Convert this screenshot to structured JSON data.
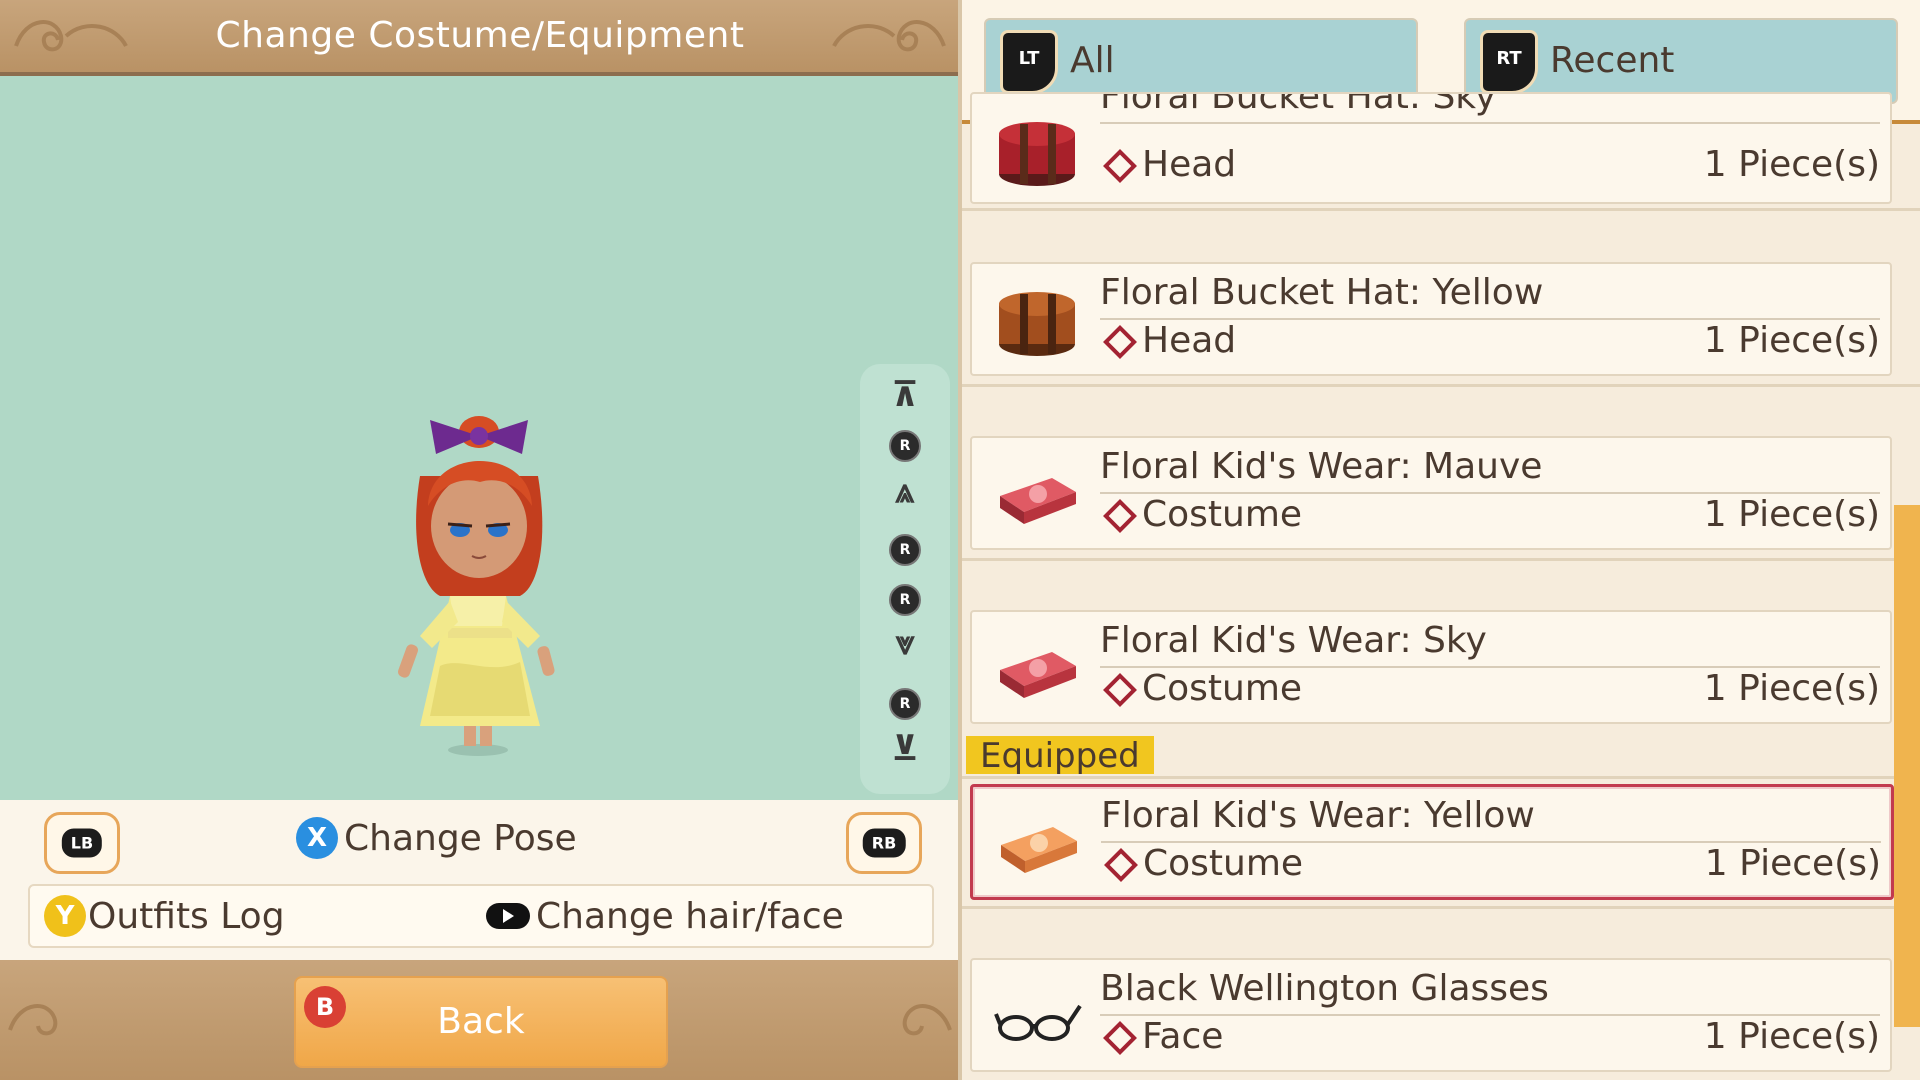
{
  "left": {
    "title": "Change Costume/Equipment",
    "camera_controls": [
      "top",
      "rotate-up",
      "zoom-in",
      "rotate-left",
      "rotate-right",
      "zoom-out",
      "rotate-down",
      "bottom"
    ],
    "camera_button_letter": "R",
    "lb_label": "LB",
    "rb_label": "RB",
    "change_pose": {
      "button": "X",
      "label": "Change Pose"
    },
    "outfits_log": {
      "button": "Y",
      "label": "Outfits Log"
    },
    "change_hair": {
      "label": "Change hair/face"
    },
    "back": {
      "button": "B",
      "label": "Back"
    }
  },
  "right": {
    "tabs": [
      {
        "badge": "LT",
        "label": "All"
      },
      {
        "badge": "RT",
        "label": "Recent"
      }
    ],
    "equipped_label": "Equipped",
    "items": [
      {
        "name": "Floral Bucket Hat: Sky",
        "slot": "Head",
        "qty": "1 Piece(s)",
        "icon": "red-hatbox-icon"
      },
      {
        "name": "Floral Bucket Hat: Yellow",
        "slot": "Head",
        "qty": "1 Piece(s)",
        "icon": "brown-hatbox-icon"
      },
      {
        "name": "Floral Kid's Wear: Mauve",
        "slot": "Costume",
        "qty": "1 Piece(s)",
        "icon": "red-clothes-case-icon"
      },
      {
        "name": "Floral Kid's Wear: Sky",
        "slot": "Costume",
        "qty": "1 Piece(s)",
        "icon": "red-clothes-case-icon"
      },
      {
        "name": "Floral Kid's Wear: Yellow",
        "slot": "Costume",
        "qty": "1 Piece(s)",
        "icon": "orange-clothes-case-icon",
        "equipped": true
      },
      {
        "name": "Black Wellington Glasses",
        "slot": "Face",
        "qty": "1 Piece(s)",
        "icon": "glasses-icon"
      }
    ]
  },
  "colors": {
    "preview_bg": "#b0d8c6",
    "tab_bg": "#a9d2d3",
    "equipped_tag": "#f1c61f",
    "equipped_border": "#c23a4e",
    "back_button": "#f0a748",
    "scrollbar": "#f0b44e"
  }
}
